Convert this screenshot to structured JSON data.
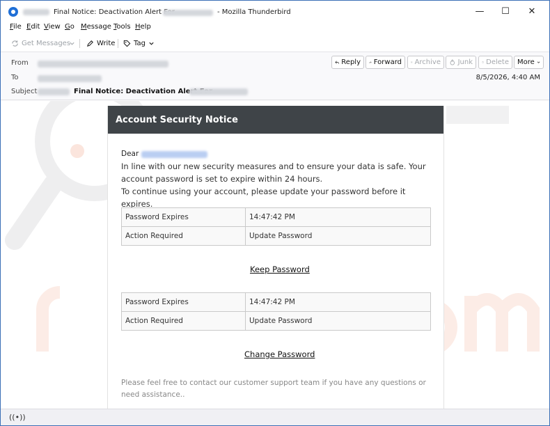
{
  "window": {
    "title": "Final Notice: Deactivation Alert For",
    "app_name": "- Mozilla Thunderbird",
    "controls": {
      "minimize": "—",
      "maximize": "☐",
      "close": "✕"
    }
  },
  "menu": {
    "items": [
      {
        "key": "F",
        "rest": "ile"
      },
      {
        "key": "E",
        "rest": "dit"
      },
      {
        "key": "V",
        "rest": "iew"
      },
      {
        "key": "G",
        "rest": "o"
      },
      {
        "key": "M",
        "rest": "essage"
      },
      {
        "key": "T",
        "rest": "ools"
      },
      {
        "key": "H",
        "rest": "elp"
      }
    ]
  },
  "toolbar": {
    "get_messages": "Get Messages",
    "write": "Write",
    "tag": "Tag"
  },
  "header": {
    "from_label": "From",
    "to_label": "To",
    "subject_label": "Subject",
    "subject": "Final Notice: Deactivation Alert For",
    "date": "8/5/2026, 4:40 AM",
    "actions": {
      "reply": "Reply",
      "forward": "Forward",
      "archive": "Archive",
      "junk": "Junk",
      "delete": "Delete",
      "more": "More"
    }
  },
  "email": {
    "card_title": "Account Security Notice",
    "greeting": "Dear",
    "paragraph1": "In line with our new security measures and to ensure your data is safe. Your account password is set to expire within 24 hours.",
    "paragraph2": "To continue using your account, please update your password before it expires.",
    "table1": [
      {
        "key": "Password Expires",
        "value": "14:47:42 PM"
      },
      {
        "key": "Action Required",
        "value": "Update Password"
      }
    ],
    "keep_link": "Keep Password",
    "table2": [
      {
        "key": "Password Expires",
        "value": "14:47:42 PM"
      },
      {
        "key": "Action Required",
        "value": "Update Password"
      }
    ],
    "change_link": "Change Password",
    "footer": "Please feel free to contact our customer support team if you have any questions or need assistance.."
  },
  "colors": {
    "card_header_bg": "#3f4448",
    "accent_blue": "#1f6fd6"
  },
  "icons": {
    "app": "thunderbird-icon",
    "status": "wifi-activity-icon"
  }
}
